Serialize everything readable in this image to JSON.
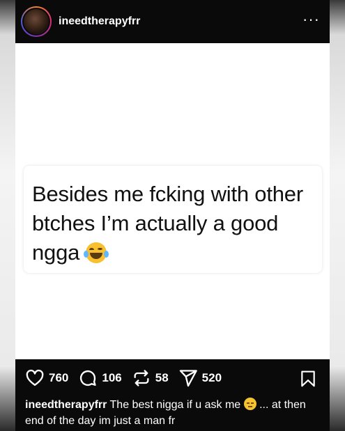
{
  "header": {
    "username": "ineedtherapyfrr",
    "more_label": "···"
  },
  "post": {
    "quote_text": "Besides me fcking with other btches I’m actually a good ngga",
    "quote_emoji": "face-with-tears-of-joy-icon"
  },
  "actions": {
    "likes": "760",
    "comments": "106",
    "reposts": "58",
    "shares": "520"
  },
  "caption": {
    "username": "ineedtherapyfrr",
    "text_before_emoji": "The best nigga if u ask me",
    "emoji": "pensive-face-icon",
    "text_after_emoji": "... at then end of the day im just a man fr"
  },
  "colors": {
    "bar_background": "#0a0a0a",
    "text_light": "#ffffff",
    "avatar_ring": "#dd2a7b"
  }
}
